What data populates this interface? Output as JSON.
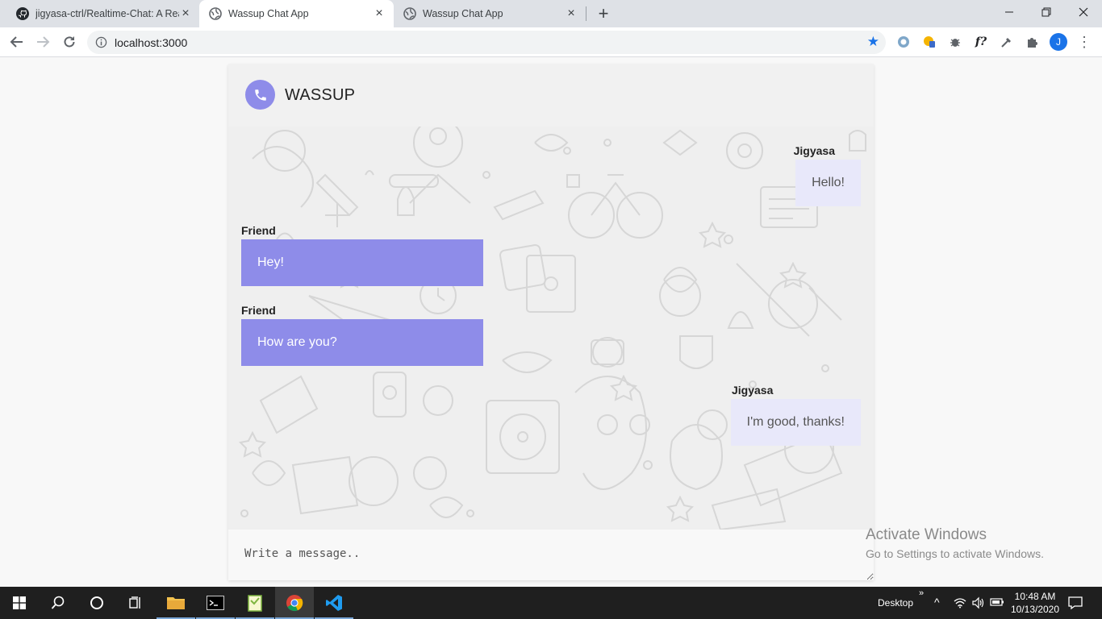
{
  "browser": {
    "tabs": [
      {
        "title": "jigyasa-ctrl/Realtime-Chat: A Rea",
        "icon": "github-icon"
      },
      {
        "title": "Wassup Chat App",
        "icon": "globe-icon",
        "active": true
      },
      {
        "title": "Wassup Chat App",
        "icon": "globe-icon"
      }
    ],
    "url": "localhost:3000",
    "profile_initial": "J",
    "accent": "#1a73e8"
  },
  "app": {
    "brand": "WASSUP",
    "accent": "#8e8ce9",
    "messages": [
      {
        "sender": "Jigyasa",
        "text": "Hello!",
        "side": "me"
      },
      {
        "sender": "Friend",
        "text": "Hey!",
        "side": "friend"
      },
      {
        "sender": "Friend",
        "text": "How are you?",
        "side": "friend"
      },
      {
        "sender": "Jigyasa",
        "text": "I'm good, thanks!",
        "side": "me"
      }
    ],
    "composer_placeholder": "Write a message.."
  },
  "watermark": {
    "line1": "Activate Windows",
    "line2": "Go to Settings to activate Windows."
  },
  "taskbar": {
    "desktop_label": "Desktop",
    "time": "10:48 AM",
    "date": "10/13/2020"
  }
}
